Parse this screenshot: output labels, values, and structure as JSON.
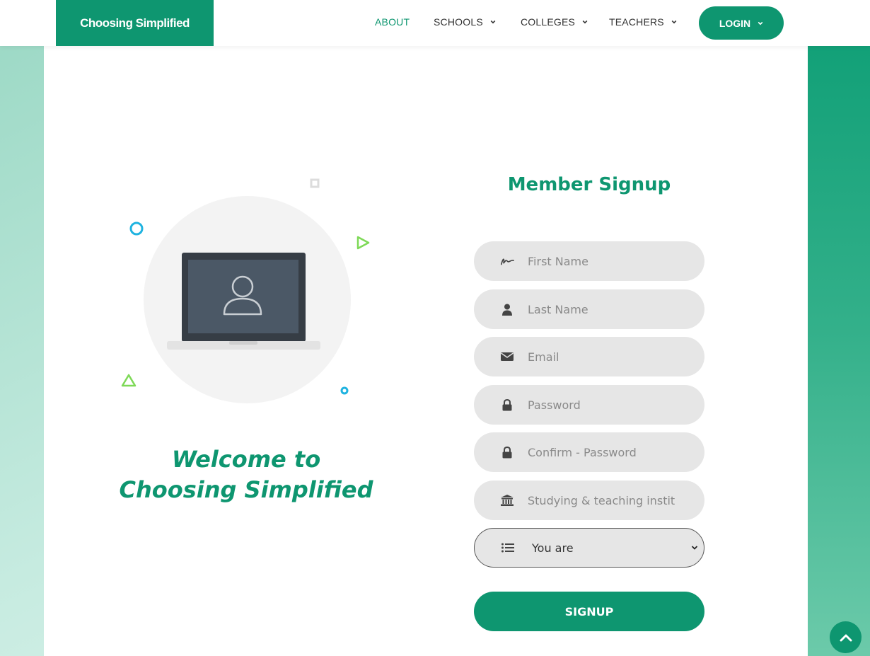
{
  "header": {
    "logo_text": "Choosing Simplified",
    "nav": [
      {
        "label": "ABOUT",
        "has_dropdown": false,
        "active": true
      },
      {
        "label": "SCHOOLS",
        "has_dropdown": true,
        "active": false
      },
      {
        "label": "COLLEGES",
        "has_dropdown": true,
        "active": false
      },
      {
        "label": "TEACHERS",
        "has_dropdown": true,
        "active": false
      }
    ],
    "login_label": "LOGIN"
  },
  "welcome": {
    "line1": "Welcome to",
    "line2": "Choosing Simplified"
  },
  "form": {
    "title": "Member Signup",
    "fields": [
      {
        "placeholder": "First Name",
        "icon": "signature-icon"
      },
      {
        "placeholder": "Last Name",
        "icon": "user-icon"
      },
      {
        "placeholder": "Email",
        "icon": "envelope-icon"
      },
      {
        "placeholder": "Password",
        "icon": "lock-icon"
      },
      {
        "placeholder": "Confirm - Password",
        "icon": "lock-icon"
      },
      {
        "placeholder": "Studying & teaching instit",
        "icon": "institution-icon"
      }
    ],
    "role_select": {
      "value": "You are",
      "icon": "list-icon"
    },
    "submit_label": "SIGNUP"
  },
  "colors": {
    "brand": "#0e9670",
    "field_bg": "#e6e6e6",
    "placeholder": "#8a8a8a"
  }
}
